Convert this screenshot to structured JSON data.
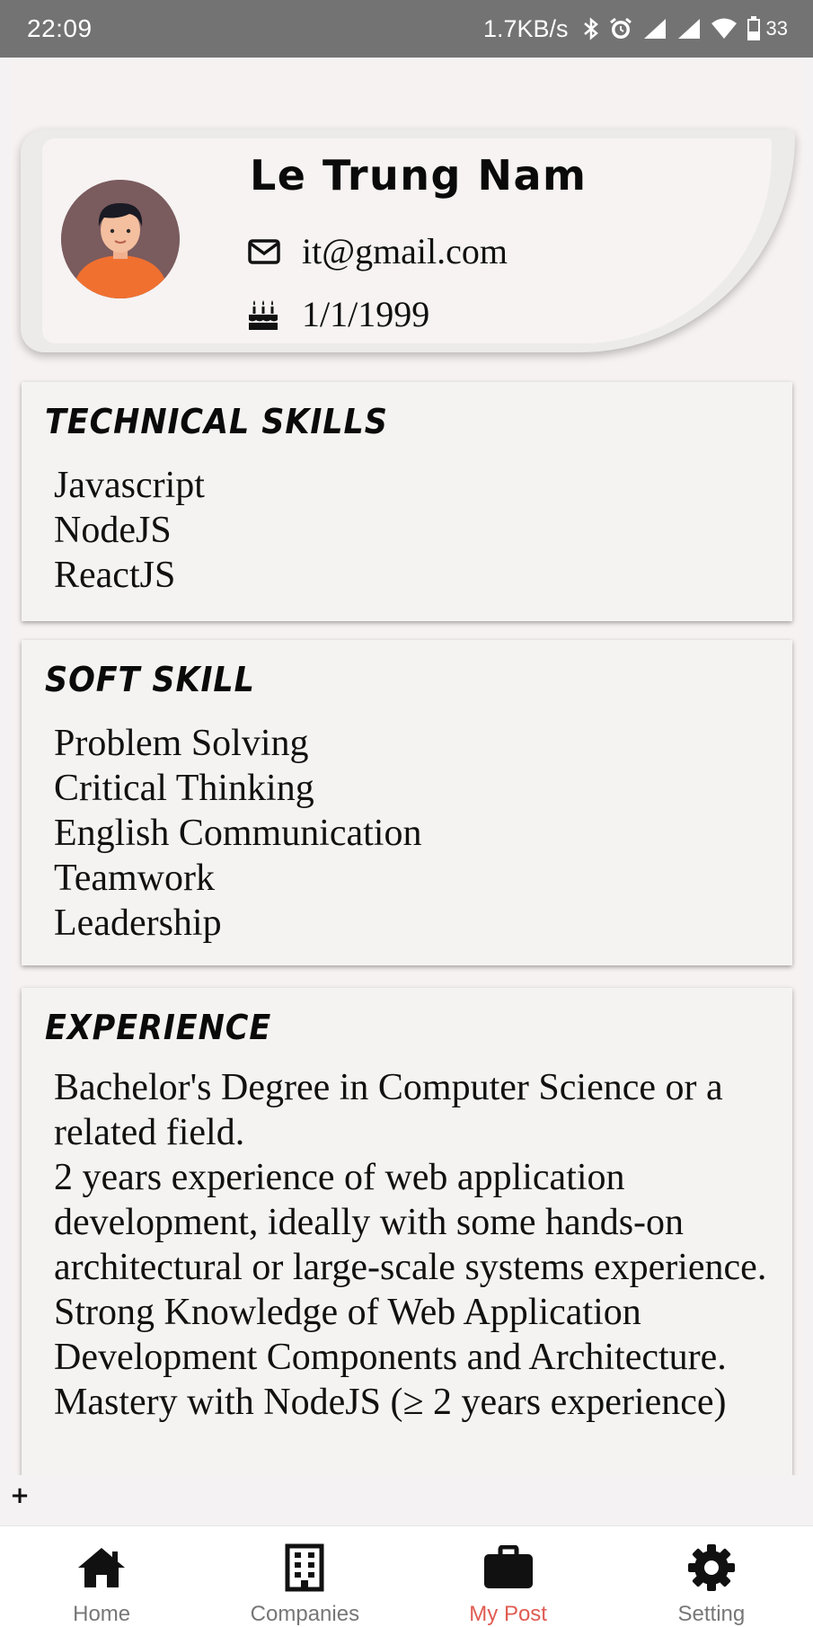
{
  "status_bar": {
    "time": "22:09",
    "network_speed": "1.7KB/s",
    "battery_level": "33",
    "icons": [
      "bluetooth-icon",
      "alarm-icon",
      "signal-icon",
      "signal-icon",
      "wifi-icon",
      "battery-icon"
    ]
  },
  "profile": {
    "name": "Le Trung Nam",
    "email": "it@gmail.com",
    "birthday": "1/1/1999",
    "email_icon": "envelope-icon",
    "birthday_icon": "birthday-cake-icon",
    "avatar_colors": {
      "background": "#7a5b5e",
      "shirt": "#f07030"
    }
  },
  "sections": {
    "technical": {
      "title": "TECHNICAL SKILLS",
      "items": [
        "Javascript",
        "NodeJS",
        "ReactJS"
      ]
    },
    "soft": {
      "title": "SOFT SKILL",
      "items": [
        "Problem Solving",
        "Critical Thinking",
        "English Communication",
        "Teamwork",
        "Leadership"
      ]
    },
    "experience": {
      "title": "EXPERIENCE",
      "items": [
        "Bachelor's Degree in Computer Science or a related field.",
        "2 years experience of web application development, ideally with some hands-on architectural or large-scale systems experience.",
        "Strong Knowledge of Web Application Development Components and Architecture.",
        "Mastery with NodeJS (≥ 2 years experience)"
      ]
    }
  },
  "fab": {
    "label": "+"
  },
  "bottom_nav": {
    "items": [
      {
        "label": "Home",
        "icon": "home-icon"
      },
      {
        "label": "Companies",
        "icon": "building-icon"
      },
      {
        "label": "My Post",
        "icon": "briefcase-icon"
      },
      {
        "label": "Setting",
        "icon": "gear-icon"
      }
    ],
    "active": "My Post",
    "active_color": "#e05c52",
    "inactive_color": "#777777"
  }
}
